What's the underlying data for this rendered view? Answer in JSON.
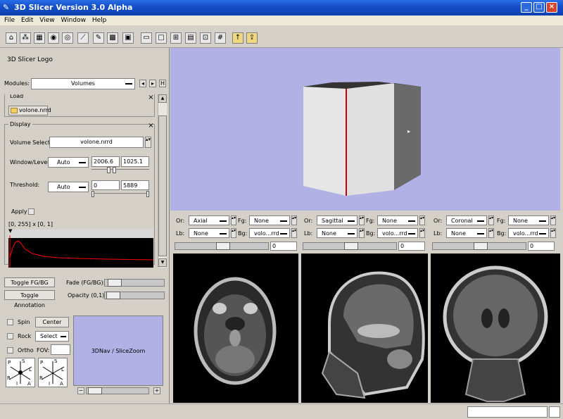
{
  "window": {
    "title": "3D Slicer Version 3.0 Alpha",
    "buttons": [
      "_",
      "□",
      "×"
    ]
  },
  "menu": [
    "File",
    "Edit",
    "View",
    "Window",
    "Help"
  ],
  "logo": "3D Slicer Logo",
  "modules": {
    "label": "Modules:",
    "value": "Volumes"
  },
  "load": {
    "title": "Load",
    "file": "volone.nrrd"
  },
  "display": {
    "title": "Display",
    "volume_label": "Volume Select:",
    "volume_value": "volone.nrrd",
    "wl_label": "Window/Level:",
    "wl_mode": "Auto",
    "window": "2006.6",
    "level": "1025.1",
    "th_label": "Threshold:",
    "th_mode": "Auto",
    "th_min": "0",
    "th_max": "5889",
    "apply": "Apply",
    "range": "[0, 255] x [0, 1]"
  },
  "bottom": {
    "toggle_fgbg": "Toggle FG/BG",
    "toggle_annot": "Toggle Annotation",
    "fade": "Fade (FG/BG):",
    "opacity": "Opacity (0,1):",
    "spin": "Spin",
    "center": "Center",
    "rock": "Rock",
    "select": "Select",
    "ortho": "Ortho",
    "fov": "FOV:",
    "nav": "3DNav / SliceZoom",
    "minus": "−",
    "plus": "+"
  },
  "slices": [
    {
      "or_label": "Or:",
      "or": "Axial",
      "fg_label": "Fg:",
      "fg": "None",
      "lb_label": "Lb:",
      "lb": "None",
      "bg_label": "Bg:",
      "bg": "volo...rrd",
      "offset": "0"
    },
    {
      "or_label": "Or:",
      "or": "Sagittal",
      "fg_label": "Fg:",
      "fg": "None",
      "lb_label": "Lb:",
      "lb": "None",
      "bg_label": "Bg:",
      "bg": "volo...rrd",
      "offset": "0"
    },
    {
      "or_label": "Or:",
      "or": "Coronal",
      "fg_label": "Fg:",
      "fg": "None",
      "lb_label": "Lb:",
      "lb": "None",
      "bg_label": "Bg:",
      "bg": "volo...rrd",
      "offset": "0"
    }
  ],
  "compass": {
    "p": "P",
    "s": "S",
    "r": "R",
    "l": "L",
    "i": "I",
    "a": "A"
  },
  "colors": {
    "view_bg": "#b1b1e5",
    "title": "#1550c8",
    "plot_line": "#ff0000"
  }
}
